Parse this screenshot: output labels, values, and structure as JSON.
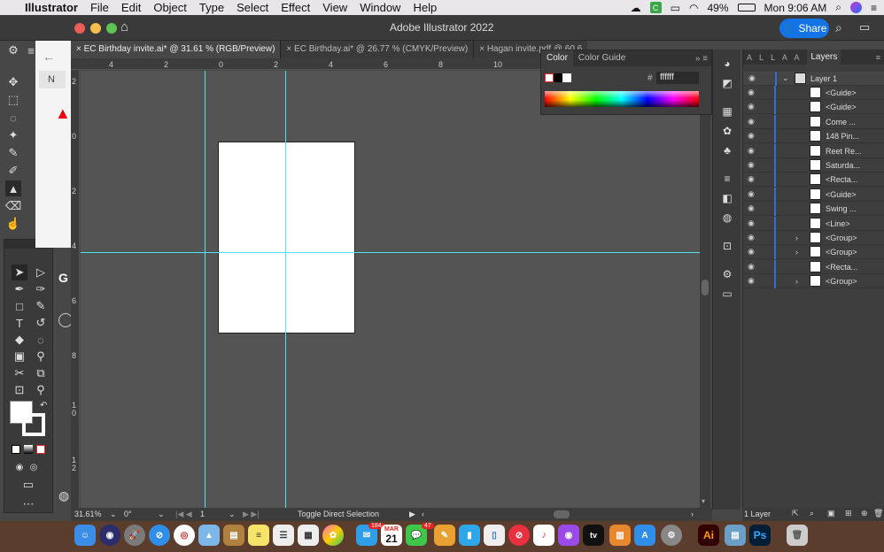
{
  "menubar": {
    "apple": "",
    "app": "Illustrator",
    "items": [
      "File",
      "Edit",
      "Object",
      "Type",
      "Select",
      "Effect",
      "View",
      "Window",
      "Help"
    ],
    "battery": "49%",
    "clock": "Mon 9:06 AM",
    "c_badge": "C"
  },
  "window": {
    "title": "Adobe Illustrator 2022",
    "share": "Share"
  },
  "tabs": [
    {
      "label": "EC Birthday invite.ai* @ 31.61 % (RGB/Preview)",
      "close": "×"
    },
    {
      "label": "EC Birthday.ai* @ 26.77 % (CMYK/Preview)",
      "close": "×"
    },
    {
      "label": "Hagan invite.pdf @ 60.6",
      "close": "×"
    }
  ],
  "ruler_h": [
    "4",
    "2",
    "0",
    "2",
    "4",
    "6",
    "8",
    "10"
  ],
  "ruler_v": [
    "2",
    "0",
    "2",
    "4",
    "6",
    "8",
    "1\n0",
    "1\n2"
  ],
  "color_panel": {
    "tab_color": "Color",
    "tab_guide": "Color Guide",
    "hex_symbol": "#",
    "hex_value": "ffffff"
  },
  "layers": {
    "tab": "Layers",
    "header_other": "A L L A A",
    "layer_name": "Layer 1",
    "items": [
      "<Guide>",
      "<Guide>",
      "Come ...",
      "148 Pin...",
      "Reet Re...",
      "Saturda...",
      "<Recta...",
      "<Guide>",
      "Swing ...",
      "<Line>",
      "<Group>",
      "<Group>",
      "<Recta...",
      "<Group>"
    ],
    "footer": "1 Layer"
  },
  "status": {
    "zoom": "31.61%",
    "rotate": "0°",
    "artboard": "1",
    "tool": "Toggle Direct Selection"
  },
  "browser_sliver": {
    "letter": "N"
  },
  "overlay_letter": "G",
  "dock": {
    "calendar_month": "MAR",
    "calendar_day": "21",
    "badge_mail": "184",
    "badge_messages": "47",
    "appletv": "tv",
    "ai": "Ai",
    "ps": "Ps"
  }
}
